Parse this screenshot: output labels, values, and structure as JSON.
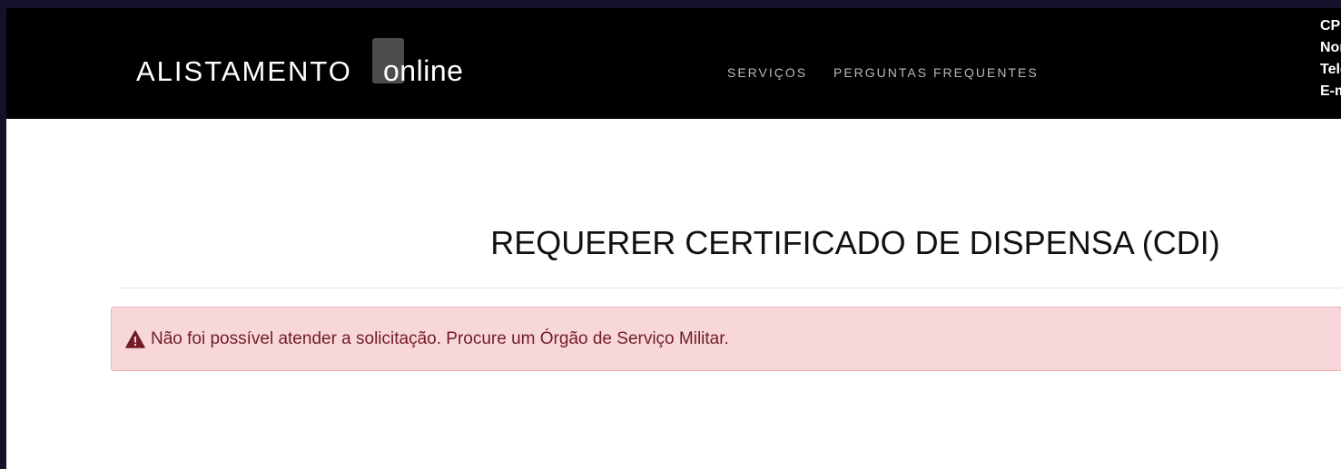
{
  "navbar": {
    "brand_main": "ALISTAMENTO",
    "brand_suffix": "online",
    "links": [
      "SERVIÇOS",
      "PERGUNTAS FREQUENTES"
    ],
    "user_info": [
      "CPF",
      "Nome",
      "Telefone",
      "E-mail"
    ]
  },
  "main": {
    "title": "REQUERER CERTIFICADO DE DISPENSA (CDI)",
    "alert": {
      "icon": "warning-icon",
      "message": "Não foi possível atender a solicitação. Procure um Órgão de Serviço Militar.",
      "background_color": "#f8d7da",
      "text_color": "#721c24"
    }
  }
}
